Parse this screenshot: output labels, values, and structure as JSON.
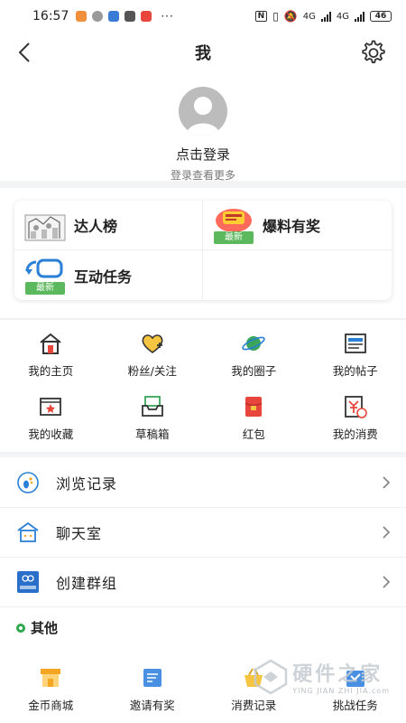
{
  "status_bar": {
    "time": "16:57",
    "dots": "···",
    "net1": "4G",
    "net2": "4G",
    "battery": "46"
  },
  "header": {
    "title": "我"
  },
  "profile": {
    "login_text": "点击登录",
    "login_sub": "登录查看更多"
  },
  "featured": [
    {
      "label": "达人榜",
      "icon": "ranking-illustration-icon"
    },
    {
      "label": "爆料有奖",
      "icon": "tip-reward-icon",
      "tag": "最新"
    },
    {
      "label": "互动任务",
      "icon": "interactive-task-icon",
      "tag": "最新"
    }
  ],
  "grid": [
    {
      "label": "我的主页",
      "icon": "home-icon"
    },
    {
      "label": "粉丝/关注",
      "icon": "heart-follow-icon"
    },
    {
      "label": "我的圈子",
      "icon": "planet-icon"
    },
    {
      "label": "我的帖子",
      "icon": "post-icon"
    },
    {
      "label": "我的收藏",
      "icon": "favorite-icon"
    },
    {
      "label": "草稿箱",
      "icon": "draft-box-icon"
    },
    {
      "label": "红包",
      "icon": "red-packet-icon"
    },
    {
      "label": "我的消费",
      "icon": "consumption-icon"
    }
  ],
  "list": [
    {
      "label": "浏览记录",
      "icon": "footprint-icon"
    },
    {
      "label": "聊天室",
      "icon": "chatroom-icon"
    },
    {
      "label": "创建群组",
      "icon": "create-group-icon",
      "badge": "创建群组"
    }
  ],
  "other": {
    "title": "其他",
    "items": [
      {
        "label": "金币商城",
        "icon": "store-icon"
      },
      {
        "label": "邀请有奖",
        "icon": "invite-icon"
      },
      {
        "label": "消费记录",
        "icon": "basket-icon"
      },
      {
        "label": "挑战任务",
        "icon": "challenge-icon"
      }
    ]
  },
  "watermark": {
    "main": "硬件之家",
    "sub": "YING JIAN ZHI JIA.com"
  },
  "colors": {
    "accent_green": "#2ea84a",
    "tag_green": "#5cb85c",
    "icon_blue": "#3a7bd5",
    "icon_red": "#e8453c",
    "icon_orange": "#f5a623"
  }
}
